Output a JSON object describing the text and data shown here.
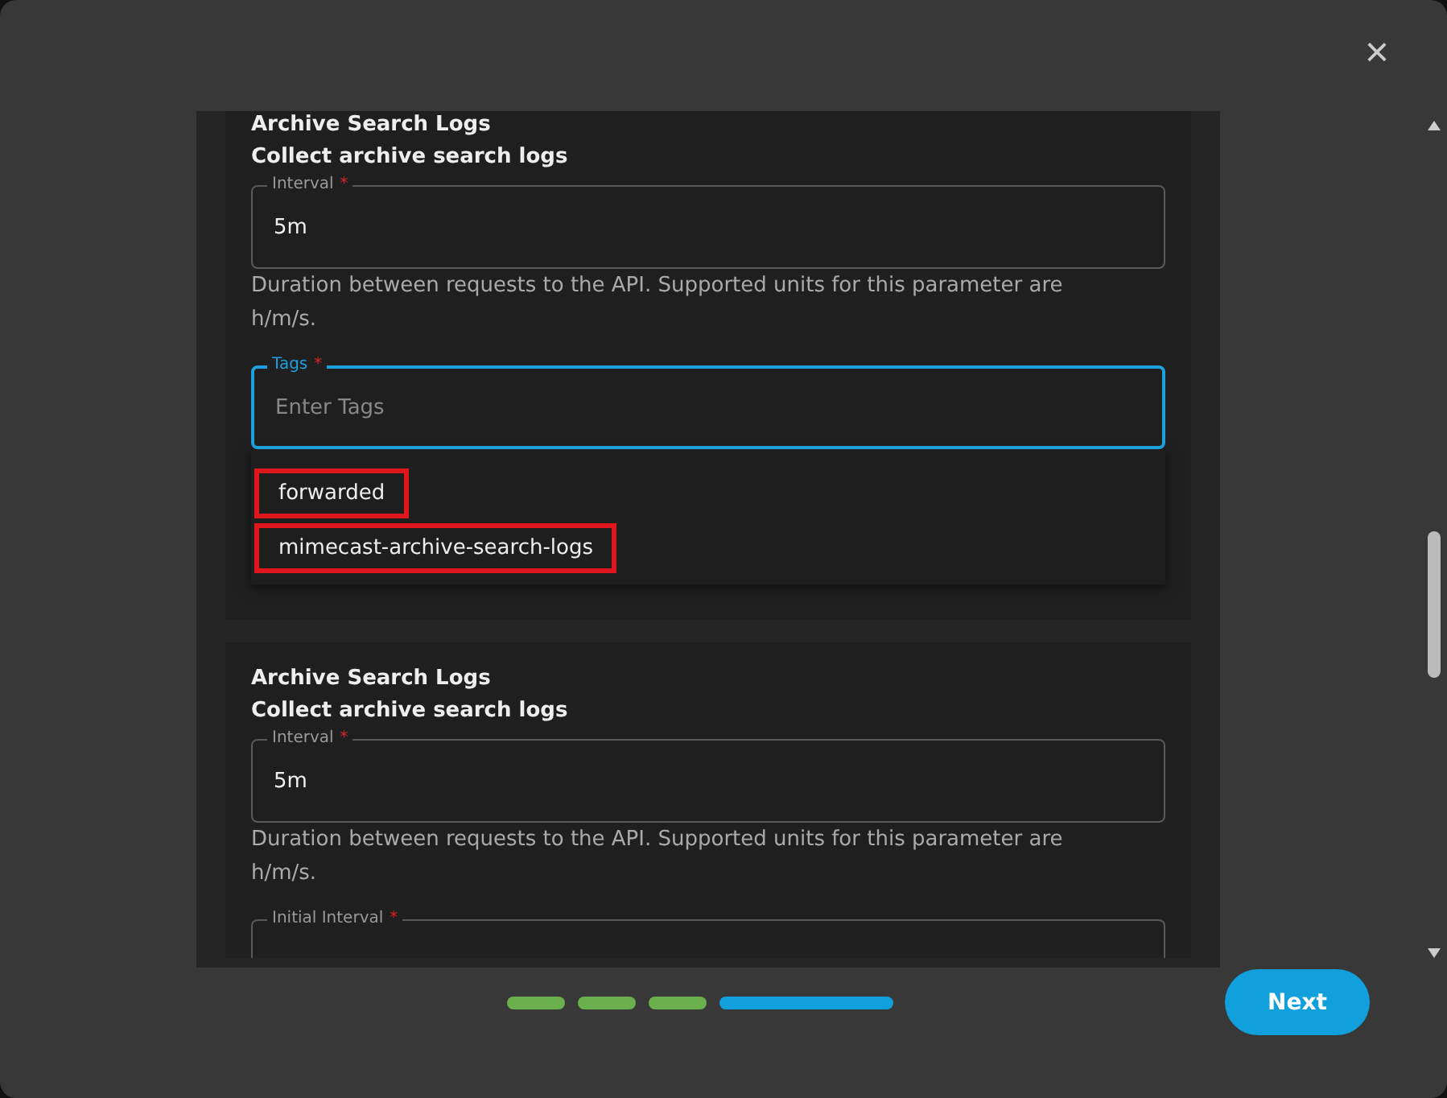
{
  "dialog": {
    "close": "×"
  },
  "cards": [
    {
      "title": "Archive Search Logs",
      "subtitle": "Collect archive search logs",
      "fields": [
        {
          "kind": "text",
          "label": "Interval",
          "required_mark": "*",
          "value": "5m",
          "focused": false,
          "help": "Duration between requests to the API. Supported units for this parameter are h/m/s."
        },
        {
          "kind": "tags",
          "label": "Tags",
          "required_mark": "*",
          "placeholder": "Enter Tags",
          "focused": true,
          "options": [
            {
              "label": "forwarded",
              "highlighted": true
            },
            {
              "label": "mimecast-archive-search-logs",
              "highlighted": true
            }
          ]
        }
      ]
    },
    {
      "title": "Archive Search Logs",
      "subtitle": "Collect archive search logs",
      "fields": [
        {
          "kind": "text",
          "label": "Interval",
          "required_mark": "*",
          "value": "5m",
          "focused": false,
          "help": "Duration between requests to the API. Supported units for this parameter are h/m/s."
        },
        {
          "kind": "text",
          "label": "Initial Interval",
          "required_mark": "*",
          "focused": false
        }
      ]
    }
  ],
  "steps": [
    {
      "completed": true,
      "current": false
    },
    {
      "completed": true,
      "current": false
    },
    {
      "completed": true,
      "current": false
    },
    {
      "completed": false,
      "current": true
    }
  ],
  "next_button": "Next"
}
